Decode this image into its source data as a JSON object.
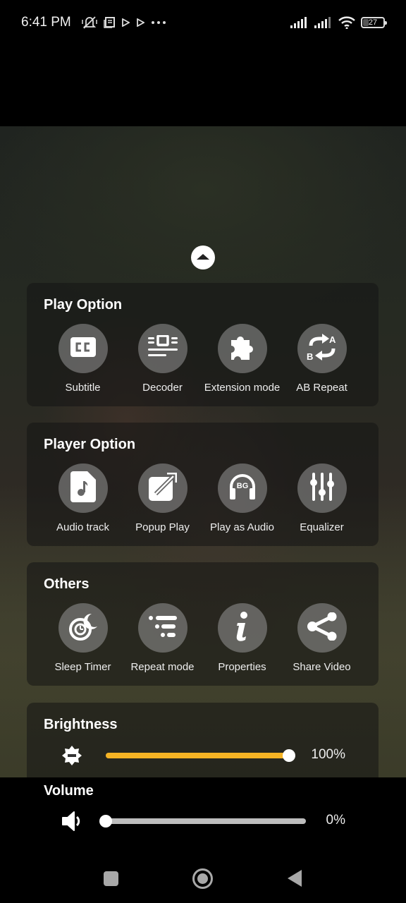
{
  "status_bar": {
    "time": "6:41 PM",
    "battery": "27",
    "left_icons": [
      "vibrate-off-icon",
      "notes-icon",
      "play-store-icon",
      "play-store-icon",
      "more-dots-icon"
    ],
    "right_icons": [
      "signal-icon",
      "signal-icon",
      "wifi-icon",
      "battery-icon"
    ]
  },
  "collapse_button": {
    "icon": "chevron-up-icon"
  },
  "sections": {
    "play_option": {
      "title": "Play Option",
      "items": [
        {
          "label": "Subtitle",
          "icon": "closed-caption-icon"
        },
        {
          "label": "Decoder",
          "icon": "decoder-icon"
        },
        {
          "label": "Extension mode",
          "icon": "puzzle-icon"
        },
        {
          "label": "AB Repeat",
          "icon": "ab-repeat-icon"
        }
      ]
    },
    "player_option": {
      "title": "Player Option",
      "items": [
        {
          "label": "Audio track",
          "icon": "audio-file-icon"
        },
        {
          "label": "Popup Play",
          "icon": "popup-icon"
        },
        {
          "label": "Play as Audio",
          "icon": "headphones-bg-icon",
          "badge": "BG"
        },
        {
          "label": "Equalizer",
          "icon": "equalizer-icon"
        }
      ]
    },
    "others": {
      "title": "Others",
      "items": [
        {
          "label": "Sleep Timer",
          "icon": "sleep-timer-icon"
        },
        {
          "label": "Repeat mode",
          "icon": "repeat-list-icon"
        },
        {
          "label": "Properties",
          "icon": "info-icon"
        },
        {
          "label": "Share Video",
          "icon": "share-icon"
        }
      ]
    }
  },
  "brightness": {
    "title": "Brightness",
    "value_percent": 100,
    "value_text": "100%",
    "accent_color": "#f5b324"
  },
  "volume": {
    "title": "Volume",
    "value_percent": 0,
    "value_text": "0%",
    "track_color": "#bdbdbd"
  },
  "nav_bar": {
    "buttons": [
      "recents",
      "home",
      "back"
    ]
  }
}
